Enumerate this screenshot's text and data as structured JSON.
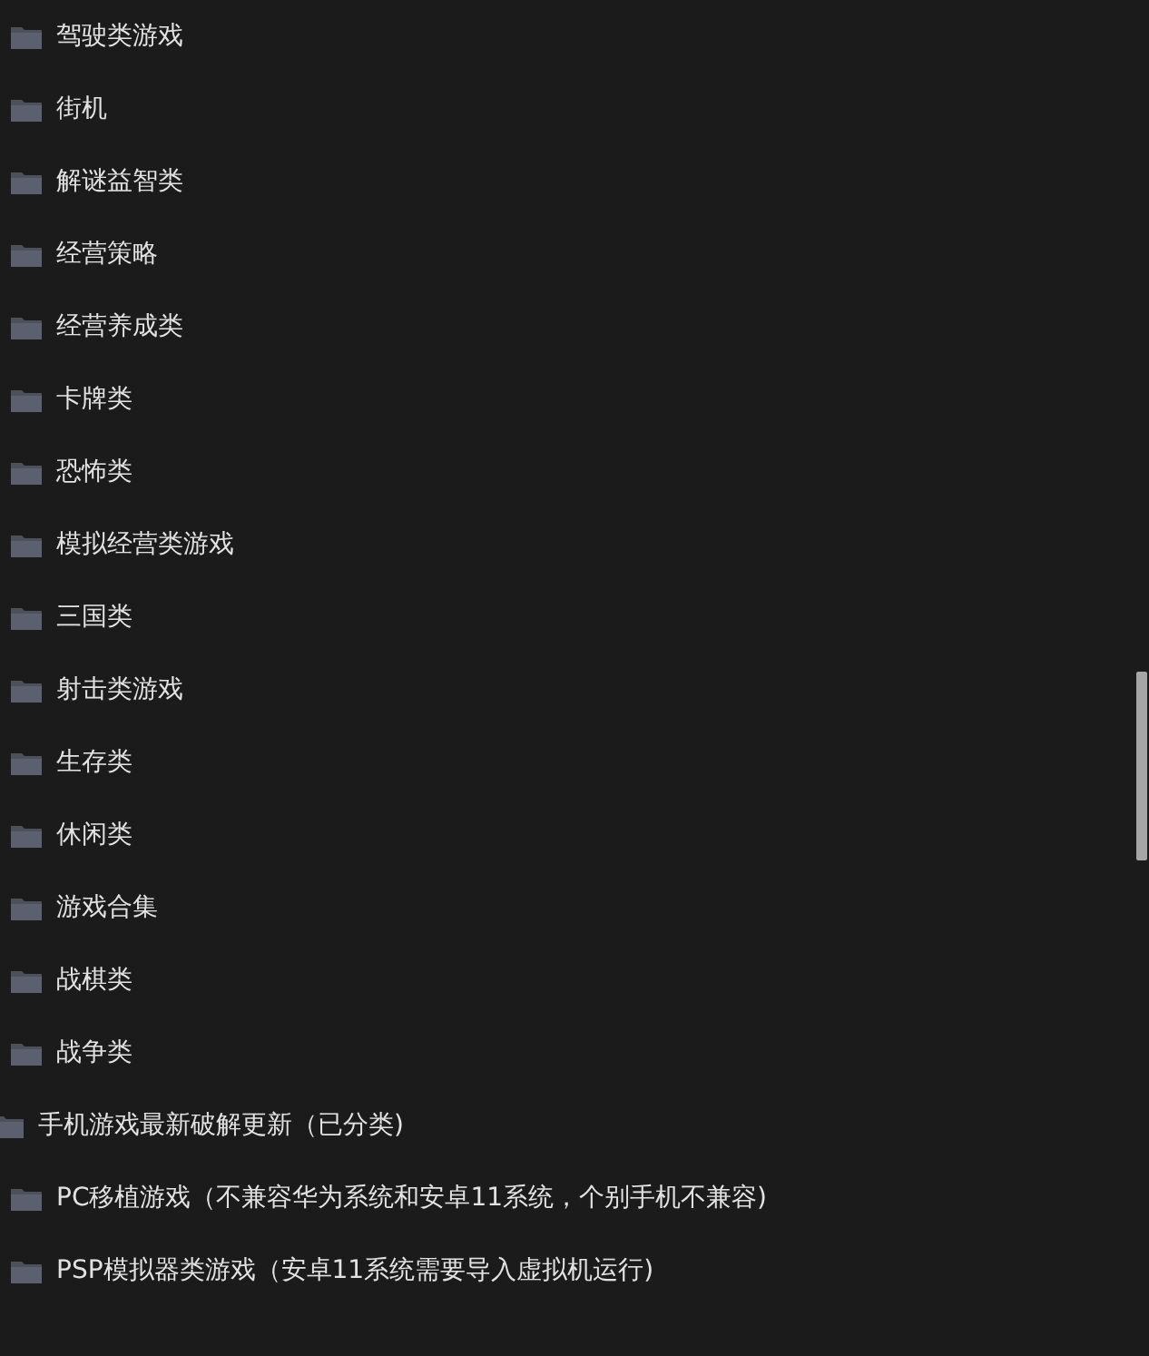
{
  "continued_items": [
    {
      "label": "驾驶类游戏"
    },
    {
      "label": "街机"
    },
    {
      "label": "解谜益智类"
    },
    {
      "label": "经营策略"
    },
    {
      "label": "经营养成类"
    },
    {
      "label": "卡牌类"
    },
    {
      "label": "恐怖类"
    },
    {
      "label": "模拟经营类游戏"
    },
    {
      "label": "三国类"
    },
    {
      "label": "射击类游戏"
    },
    {
      "label": "生存类"
    },
    {
      "label": "休闲类"
    },
    {
      "label": "游戏合集"
    },
    {
      "label": "战棋类"
    },
    {
      "label": "战争类"
    }
  ],
  "folders": [
    {
      "label": "手机游戏最新破解更新（已分类)",
      "children": [
        {
          "label": "PC移植游戏（不兼容华为系统和安卓11系统，个别手机不兼容)"
        },
        {
          "label": "PSP模拟器类游戏（安卓11系统需要导入虚拟机运行)"
        }
      ]
    }
  ]
}
